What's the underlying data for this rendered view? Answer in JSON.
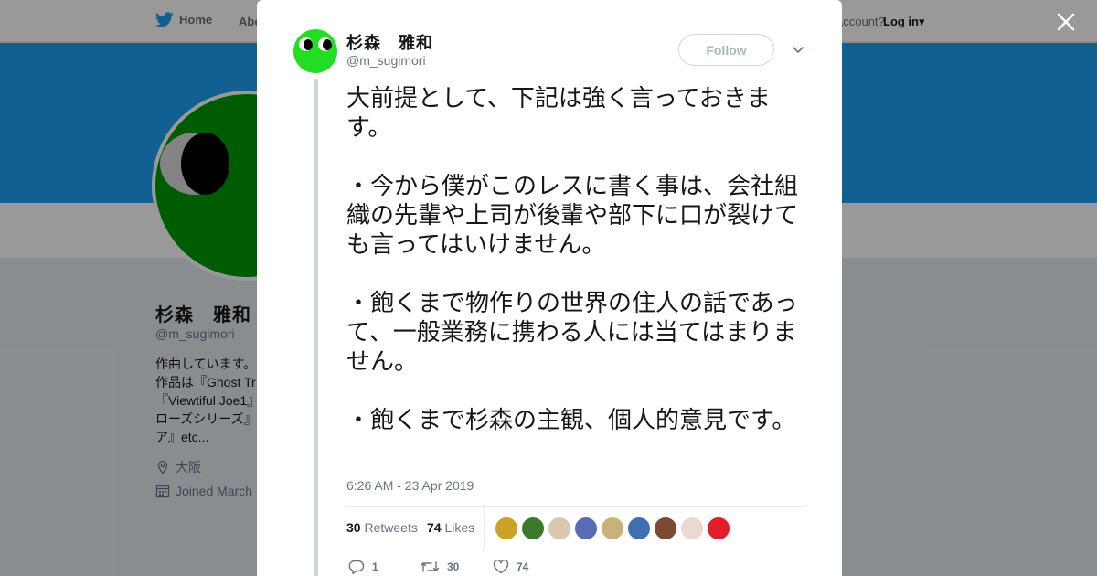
{
  "topnav": {
    "home_label": "Home",
    "about_label": "Abo",
    "account_prompt": "account?",
    "login_label": "Log in"
  },
  "profile": {
    "name": "杉森　雅和",
    "handle": "@m_sugimori",
    "bio": "作曲しています。\n作品は『Ghost Tr\n『Viewtiful Joe1』\nローズシリーズ』\nア』etc...",
    "location": "大阪",
    "joined": "Joined March"
  },
  "modal": {
    "author_name": "杉森　雅和",
    "author_handle": "@m_sugimori",
    "follow_label": "Follow",
    "tweet_paragraphs": [
      "大前提として、下記は強く言っておきます。",
      "・今から僕がこのレスに書く事は、会社組織の先輩や上司が後輩や部下に口が裂けても言ってはいけません。",
      "・飽くまで物作りの世界の住人の話であって、一般業務に携わる人には当てはまりません。",
      "・飽くまで杉森の主観、個人的意見です。"
    ],
    "timestamp": "6:26 AM - 23 Apr 2019",
    "retweets_count": "30",
    "retweets_label": "Retweets",
    "likes_count": "74",
    "likes_label": "Likes",
    "likers": [
      {
        "color": "#c9a227"
      },
      {
        "color": "#3b7a2a"
      },
      {
        "color": "#d9c7b0"
      },
      {
        "color": "#5a6bb5"
      },
      {
        "color": "#c8b27a"
      },
      {
        "color": "#3e6fb0"
      },
      {
        "color": "#7a4a32"
      },
      {
        "color": "#e9d9cf"
      },
      {
        "color": "#e01e2a"
      }
    ],
    "actions": {
      "reply_count": "1",
      "retweet_count": "30",
      "like_count": "74"
    }
  },
  "colors": {
    "brand_blue": "#1da1f2",
    "avatar_green": "#22dd22",
    "muted_text": "#657786"
  },
  "icons": [
    "twitter-bird-icon",
    "close-icon",
    "chevron-down-icon",
    "location-icon",
    "calendar-icon",
    "reply-icon",
    "retweet-icon",
    "heart-icon"
  ]
}
